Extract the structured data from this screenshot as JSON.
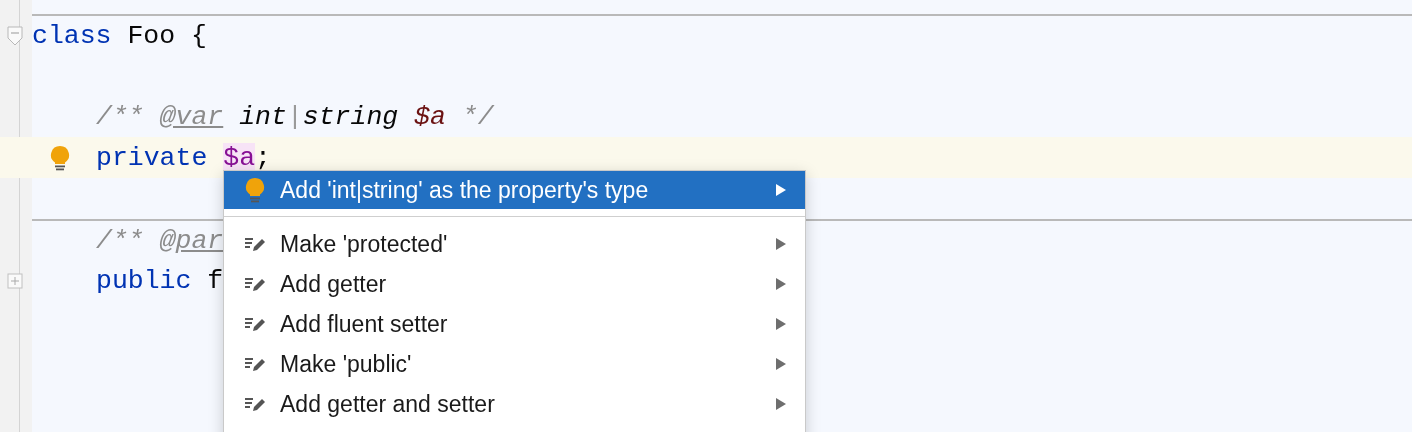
{
  "editor": {
    "lines": [
      {
        "separator": true,
        "foldable": true,
        "folded": false,
        "tokens": [
          {
            "kind": "keyword",
            "text": "class"
          },
          {
            "kind": "plain",
            "text": " Foo {"
          }
        ]
      },
      {
        "blank_line_before": true,
        "indented": true,
        "tokens": [
          {
            "kind": "comment",
            "text": "/** "
          },
          {
            "kind": "doctag",
            "text": "@var"
          },
          {
            "kind": "doctype",
            "text": " int"
          },
          {
            "kind": "pipe",
            "text": "|"
          },
          {
            "kind": "doctype",
            "text": "string"
          },
          {
            "kind": "docvar",
            "text": " $a"
          },
          {
            "kind": "comment",
            "text": " */"
          }
        ]
      },
      {
        "indented": true,
        "current": true,
        "bulb": true,
        "tokens": [
          {
            "kind": "keyword",
            "text": "private "
          },
          {
            "kind": "field_warn",
            "text": "$a"
          },
          {
            "kind": "plain",
            "text": ";"
          }
        ]
      },
      {
        "blank_line_before": true,
        "separator": true,
        "indented": true,
        "tokens": [
          {
            "kind": "comment",
            "text": "/** "
          },
          {
            "kind": "doctag",
            "text": "@par"
          }
        ]
      },
      {
        "indented": true,
        "foldable": true,
        "folded": true,
        "tokens": [
          {
            "kind": "keyword",
            "text": "public"
          },
          {
            "kind": "plain",
            "text": " f"
          }
        ]
      }
    ]
  },
  "popup": {
    "groups": [
      [
        {
          "kind": "bulb",
          "label": "Add 'int|string' as the property's type",
          "selected": true
        }
      ],
      [
        {
          "kind": "intention",
          "label": "Make 'protected'",
          "selected": false
        },
        {
          "kind": "intention",
          "label": "Add getter",
          "selected": false
        },
        {
          "kind": "intention",
          "label": "Add fluent setter",
          "selected": false
        },
        {
          "kind": "intention",
          "label": "Make 'public'",
          "selected": false
        },
        {
          "kind": "intention",
          "label": "Add getter and setter",
          "selected": false
        }
      ]
    ]
  }
}
